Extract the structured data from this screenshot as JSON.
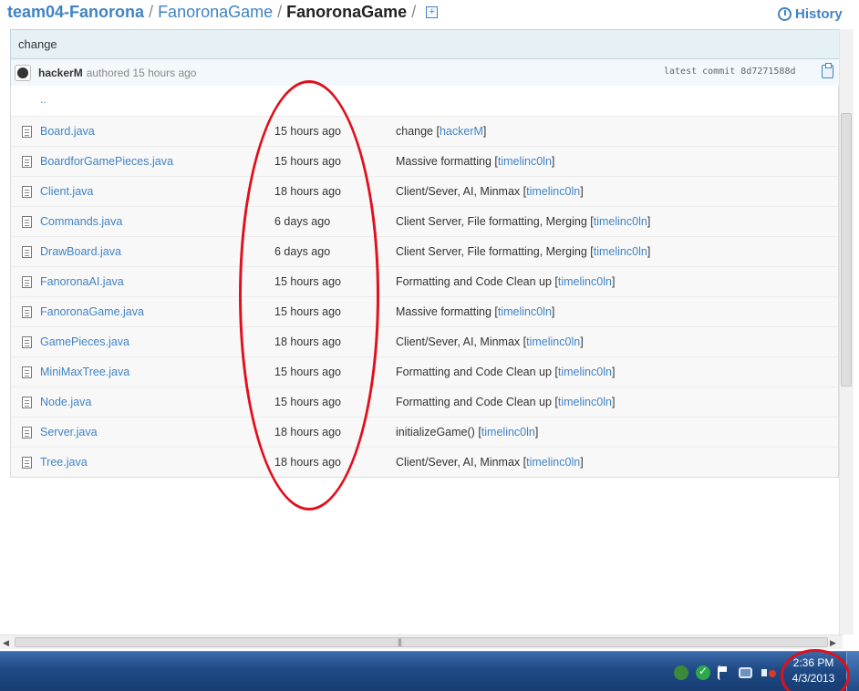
{
  "breadcrumb": {
    "repo": "team04-Fanorona",
    "sep": "/",
    "folder": "FanoronaGame",
    "current": "FanoronaGame",
    "new_file_glyph": "+"
  },
  "header": {
    "history_label": "History"
  },
  "commit": {
    "title": "change",
    "author": "hackerM",
    "authored_text": "authored 15 hours ago",
    "latest_commit_text": "latest commit 8d7271588d"
  },
  "files": {
    "up_label": "..",
    "rows": [
      {
        "name": "Board.java",
        "age": "15 hours ago",
        "message": "change",
        "author": "hackerM"
      },
      {
        "name": "BoardforGamePieces.java",
        "age": "15 hours ago",
        "message": "Massive formatting",
        "author": "timelinc0ln"
      },
      {
        "name": "Client.java",
        "age": "18 hours ago",
        "message": "Client/Sever, AI, Minmax",
        "author": "timelinc0ln"
      },
      {
        "name": "Commands.java",
        "age": "6 days ago",
        "message": "Client Server, File formatting, Merging",
        "author": "timelinc0ln"
      },
      {
        "name": "DrawBoard.java",
        "age": "6 days ago",
        "message": "Client Server, File formatting, Merging",
        "author": "timelinc0ln"
      },
      {
        "name": "FanoronaAI.java",
        "age": "15 hours ago",
        "message": "Formatting and Code Clean up",
        "author": "timelinc0ln"
      },
      {
        "name": "FanoronaGame.java",
        "age": "15 hours ago",
        "message": "Massive formatting",
        "author": "timelinc0ln"
      },
      {
        "name": "GamePieces.java",
        "age": "18 hours ago",
        "message": "Client/Sever, AI, Minmax",
        "author": "timelinc0ln"
      },
      {
        "name": "MiniMaxTree.java",
        "age": "15 hours ago",
        "message": "Formatting and Code Clean up",
        "author": "timelinc0ln"
      },
      {
        "name": "Node.java",
        "age": "15 hours ago",
        "message": "Formatting and Code Clean up",
        "author": "timelinc0ln"
      },
      {
        "name": "Server.java",
        "age": "18 hours ago",
        "message": "initializeGame()",
        "author": "timelinc0ln"
      },
      {
        "name": "Tree.java",
        "age": "18 hours ago",
        "message": "Client/Sever, AI, Minmax",
        "author": "timelinc0ln"
      }
    ]
  },
  "taskbar": {
    "time": "2:36 PM",
    "date": "4/3/2013"
  },
  "colors": {
    "link": "#4183c4",
    "annotation": "#e0101c",
    "taskbar": "#1f4a86"
  }
}
